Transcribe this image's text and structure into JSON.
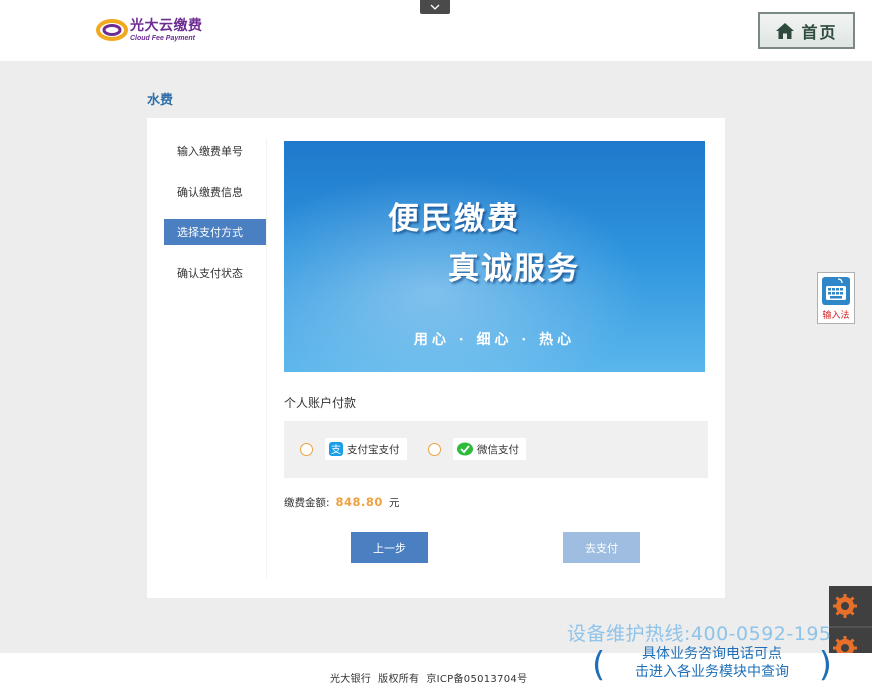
{
  "header": {
    "logo_cn": "光大云缴费",
    "logo_en": "Cloud Fee Payment",
    "home_label": "首页"
  },
  "page": {
    "title": "水费"
  },
  "steps": [
    {
      "label": "输入缴费单号",
      "active": false
    },
    {
      "label": "确认缴费信息",
      "active": false
    },
    {
      "label": "选择支付方式",
      "active": true
    },
    {
      "label": "确认支付状态",
      "active": false
    }
  ],
  "banner": {
    "line1": "便民缴费",
    "line2": "真诚服务",
    "tagline": "用心 · 细心 · 热心"
  },
  "payment": {
    "section_label": "个人账户付款",
    "options": [
      {
        "label": "支付宝支付",
        "icon": "alipay-icon",
        "selected": false
      },
      {
        "label": "微信支付",
        "icon": "wechat-icon",
        "selected": false
      }
    ]
  },
  "amount": {
    "label": "缴费金额:",
    "value": "848.80",
    "unit": "元"
  },
  "actions": {
    "prev_label": "上一步",
    "pay_label": "去支付"
  },
  "ime": {
    "label": "输入法"
  },
  "overlay": {
    "hotline": "设备维护热线:400-0592-195",
    "hint_line1": "具体业务咨询电话可点",
    "hint_line2": "击进入各业务模块中查询"
  },
  "footer": {
    "text": "光大银行  版权所有  京ICP备05013704号"
  },
  "colors": {
    "accent": "#4a7fc1",
    "accent_disabled": "#9fbde0",
    "amount": "#f0a040",
    "title": "#2f6ea8"
  }
}
